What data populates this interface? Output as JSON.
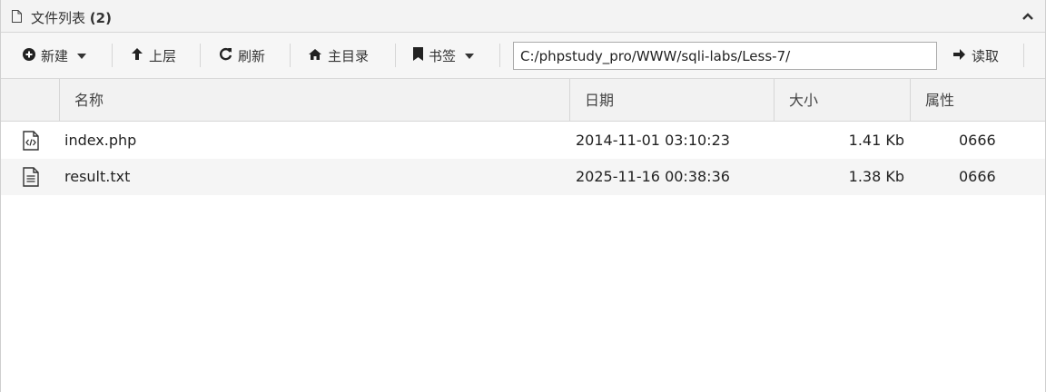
{
  "panel": {
    "title": "文件列表",
    "count": "(2)"
  },
  "toolbar": {
    "new_label": "新建",
    "up_label": "上层",
    "refresh_label": "刷新",
    "home_label": "主目录",
    "bookmark_label": "书签",
    "path_value": "C:/phpstudy_pro/WWW/sqli-labs/Less-7/",
    "read_label": "读取"
  },
  "table": {
    "columns": [
      "名称",
      "日期",
      "大小",
      "属性"
    ],
    "rows": [
      {
        "icon": "code-file-icon",
        "name": "index.php",
        "date": "2014-11-01 03:10:23",
        "size": "1.41 Kb",
        "attr": "0666"
      },
      {
        "icon": "text-file-icon",
        "name": "result.txt",
        "date": "2025-11-16 00:38:36",
        "size": "1.38 Kb",
        "attr": "0666"
      }
    ]
  }
}
